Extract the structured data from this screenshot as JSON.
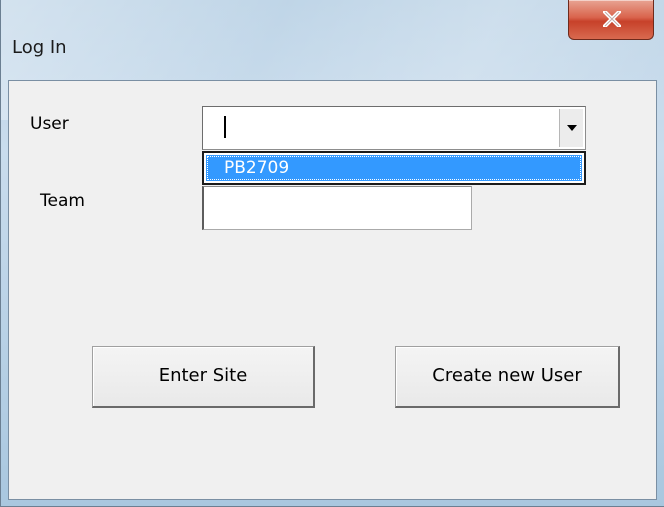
{
  "window": {
    "title": "Log In",
    "close_label": "close"
  },
  "form": {
    "user_label": "User",
    "user_value": "",
    "user_options": [
      "PB2709"
    ],
    "highlighted_option": "PB2709",
    "team_label": "Team",
    "team_value": ""
  },
  "buttons": {
    "enter_site": "Enter Site",
    "create_user": "Create new User"
  },
  "colors": {
    "selection_highlight": "#3399ff",
    "close_button": "#c7412a",
    "dialog_background": "#f0f0f0"
  },
  "icons": {
    "close": "close-icon",
    "dropdown": "chevron-down-icon"
  }
}
